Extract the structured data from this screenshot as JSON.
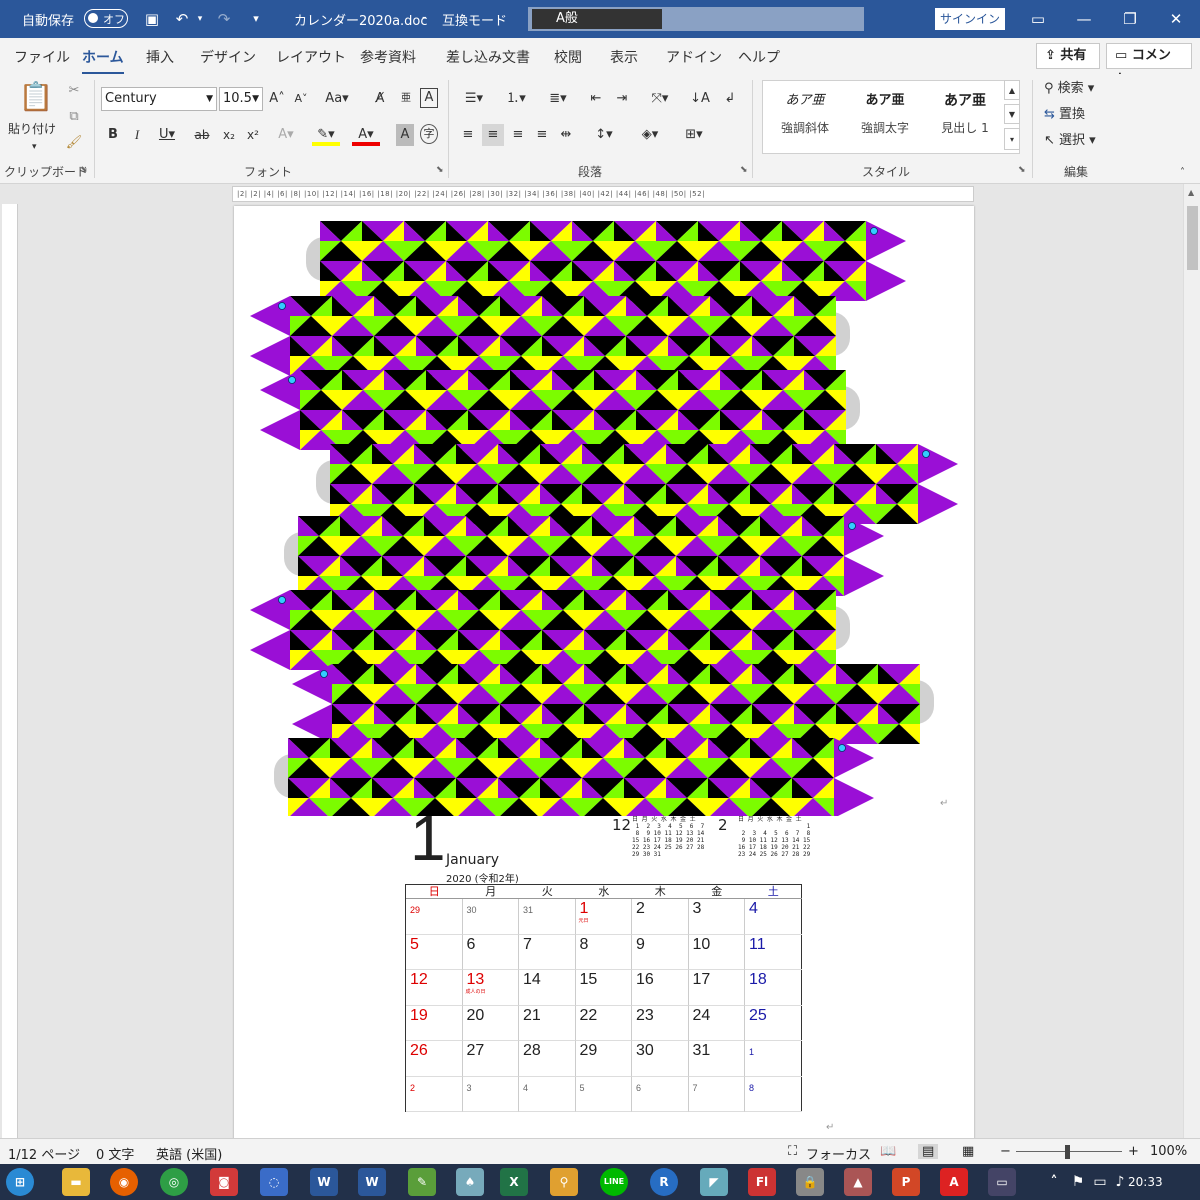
{
  "titlebar": {
    "autosave_label": "自動保存",
    "autosave_state": "オフ",
    "doc_title": "カレンダー2020a.doc",
    "mode": "互換モード",
    "ime_text": "A般",
    "signin": "サインイン"
  },
  "tabs": [
    "ファイル",
    "ホーム",
    "挿入",
    "デザイン",
    "レイアウト",
    "参考資料",
    "差し込み文書",
    "校閲",
    "表示",
    "アドイン",
    "ヘルプ"
  ],
  "share_label": "共有",
  "comment_label": "コメント",
  "ribbon": {
    "clipboard": {
      "paste": "貼り付け",
      "label": "クリップボード"
    },
    "font": {
      "name": "Century",
      "size": "10.5",
      "label": "フォント"
    },
    "paragraph": {
      "label": "段落"
    },
    "styles": {
      "label": "スタイル",
      "items": [
        {
          "sample": "あア亜",
          "name": "強調斜体"
        },
        {
          "sample": "あア亜",
          "name": "強調太字"
        },
        {
          "sample": "あア亜",
          "name": "見出し 1"
        }
      ]
    },
    "editing": {
      "label": "編集",
      "search": "検索",
      "replace": "置換",
      "select": "選択"
    }
  },
  "accent_color": "#2b579a",
  "calendar": {
    "month_number": "1",
    "month_name": "January",
    "era": "2020 (令和2年)",
    "weekdays": [
      "日",
      "月",
      "火",
      "水",
      "木",
      "金",
      "土"
    ],
    "weeks": [
      [
        "29",
        "30",
        "31",
        "1",
        "2",
        "3",
        "4"
      ],
      [
        "5",
        "6",
        "7",
        "8",
        "9",
        "10",
        "11"
      ],
      [
        "12",
        "13",
        "14",
        "15",
        "16",
        "17",
        "18"
      ],
      [
        "19",
        "20",
        "21",
        "22",
        "23",
        "24",
        "25"
      ],
      [
        "26",
        "27",
        "28",
        "29",
        "30",
        "31",
        "1"
      ],
      [
        "2",
        "3",
        "4",
        "5",
        "6",
        "7",
        "8"
      ]
    ],
    "holidays": {
      "0-3": "元日",
      "2-1": "成人の日"
    },
    "prev_month": {
      "number": "12",
      "header": "日 月 火 水 木 金 土",
      "rows": [
        " 1  2  3  4  5  6  7",
        " 8  9 10 11 12 13 14",
        "15 16 17 18 19 20 21",
        "22 23 24 25 26 27 28",
        "29 30 31"
      ]
    },
    "next_month": {
      "number": "2",
      "header": "日 月 火 水 木 金 土",
      "rows": [
        "                   1",
        " 2  3  4  5  6  7  8",
        " 9 10 11 12 13 14 15",
        "16 17 18 19 20 21 22",
        "23 24 25 26 27 28 29"
      ]
    }
  },
  "ruler": {
    "h_ticks": "|2|  |2|  |4|  |6|  |8|  |10|  |12|  |14|  |16|  |18|  |20|  |22|  |24|  |26|  |28|  |30|  |32|  |34|  |36|  |38|  |40|  |42|  |44|  |46|  |48|  |50|  |52|"
  },
  "statusbar": {
    "page": "1/12 ページ",
    "words": "0 文字",
    "language": "英語 (米国)",
    "focus": "フォーカス",
    "zoom": "100%"
  },
  "taskbar": {
    "time": "20:33"
  }
}
